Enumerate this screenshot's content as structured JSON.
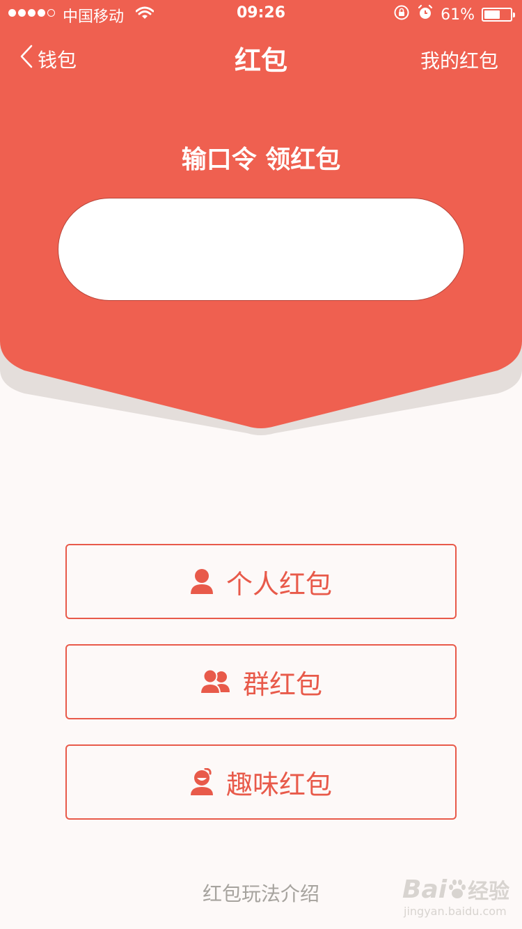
{
  "status_bar": {
    "carrier": "中国移动",
    "time": "09:26",
    "battery": "61%",
    "battery_level": 0.61,
    "signal_bars": 4,
    "signal_max": 5
  },
  "nav": {
    "back_label": "钱包",
    "title": "红包",
    "right_label": "我的红包"
  },
  "hero": {
    "subtitle": "输口令 领红包",
    "code_input": {
      "value": "",
      "placeholder": ""
    }
  },
  "buttons": [
    {
      "label": "个人红包",
      "icon": "person-icon"
    },
    {
      "label": "群红包",
      "icon": "group-icon"
    },
    {
      "label": "趣味红包",
      "icon": "fun-face-icon"
    }
  ],
  "footer": {
    "link": "红包玩法介绍"
  },
  "watermark": {
    "brand": "Bai",
    "brand_cn": "经验",
    "url": "jingyan.baidu.com"
  },
  "colors": {
    "primary": "#ef6050",
    "button_border": "#e85a4a",
    "background": "#fdf9f8",
    "footer_text": "#a6a39e"
  }
}
